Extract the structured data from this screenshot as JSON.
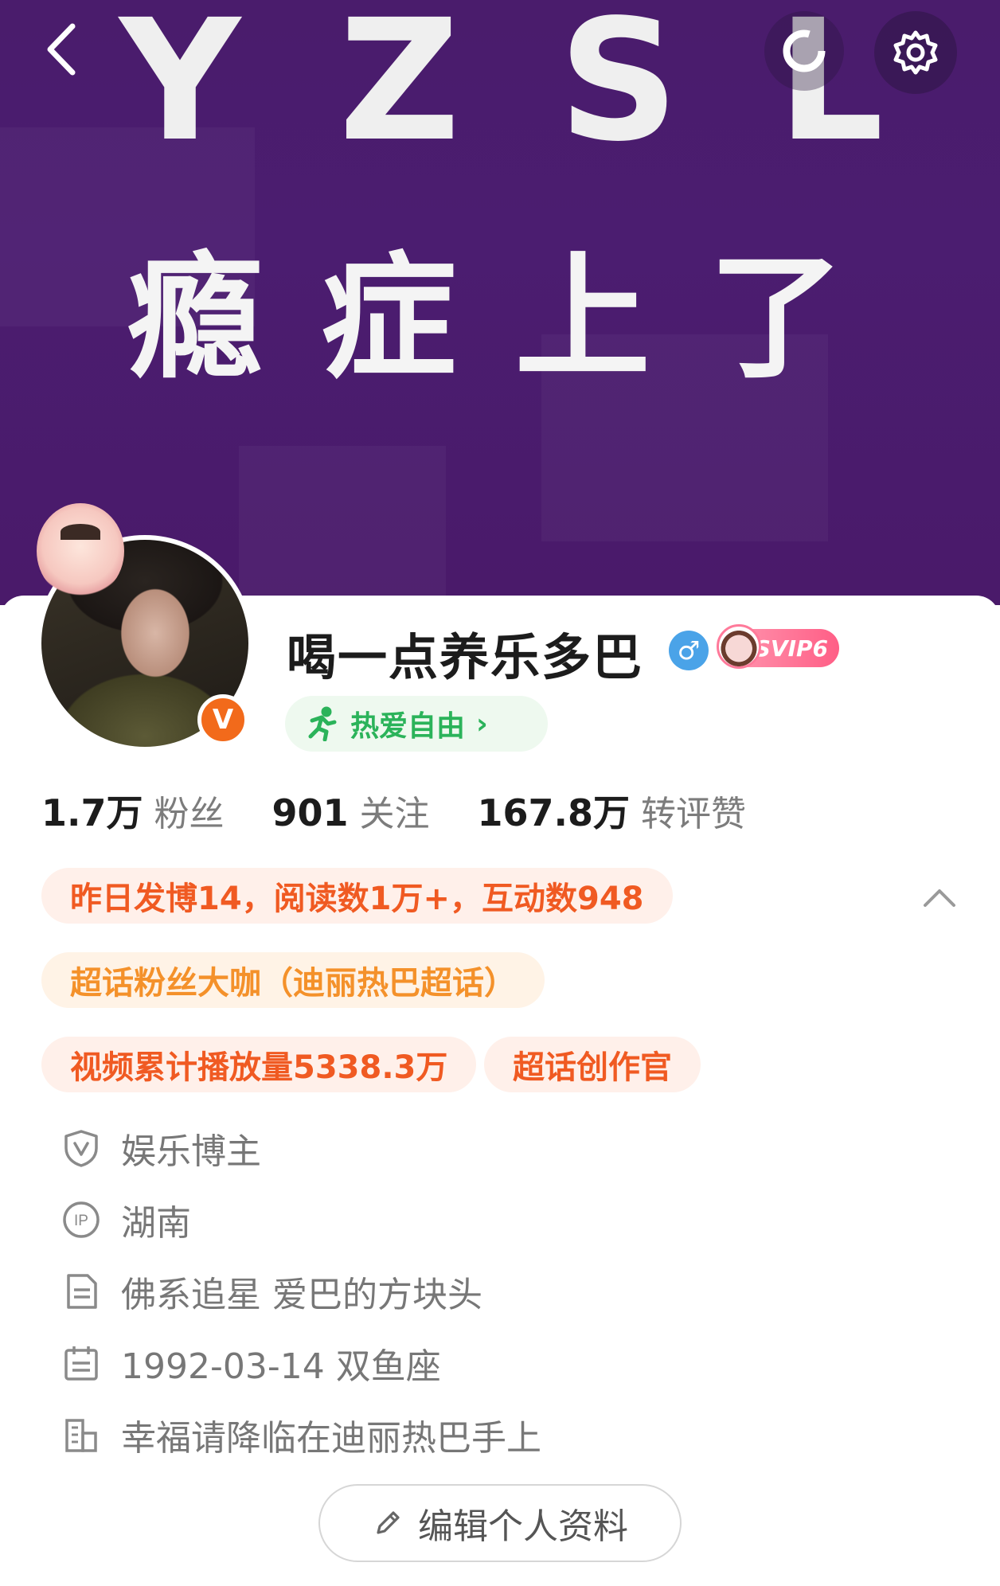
{
  "banner": {
    "letters": [
      "Y",
      "Z",
      "S",
      "L"
    ],
    "chinese": [
      "瘾",
      "症",
      "上",
      "了"
    ]
  },
  "profile": {
    "username": "喝一点养乐多巴",
    "gender_symbol": "♂",
    "vip_label": "SVIP6",
    "verified_badge": "V",
    "hobby": "热爱自由",
    "hobby_chevron": "›"
  },
  "stats": [
    {
      "value": "1.7万",
      "label": "粉丝"
    },
    {
      "value": "901",
      "label": "关注"
    },
    {
      "value": "167.8万",
      "label": "转评赞"
    }
  ],
  "tags": {
    "activity": "昨日发博14，阅读数1万+，互动数948",
    "superfan": "超话粉丝大咖（迪丽热巴超话）",
    "video_views": "视频累计播放量5338.3万",
    "creator": "超话创作官"
  },
  "info": {
    "category": "娱乐博主",
    "ip_location": "湖南",
    "bio": "佛系追星  爱巴的方块头",
    "birthday": "1992-03-14 双鱼座",
    "company": "幸福请降临在迪丽热巴手上"
  },
  "actions": {
    "edit_profile": "编辑个人资料"
  },
  "colors": {
    "banner": "#4a1c6c",
    "accent_orange": "#f05a22",
    "accent_green": "#2bb35a",
    "gender_blue": "#4aa3e8"
  }
}
